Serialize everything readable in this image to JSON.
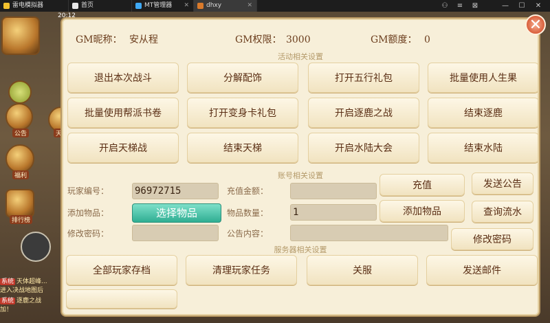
{
  "tabs": [
    {
      "label": "雷电模拟器",
      "color": "#f2c12e"
    },
    {
      "label": "首页",
      "color": "#e8e8e8"
    },
    {
      "label": "MT管理器",
      "color": "#3fa9f5"
    },
    {
      "label": "dhxy",
      "color": "#d97a2b"
    }
  ],
  "window_controls": [
    "⚇",
    "≡",
    "⊠",
    "—",
    "☐",
    "✕"
  ],
  "game": {
    "time_text": "20:12",
    "side_labels": [
      "公告",
      "天",
      "福利",
      "排行榜"
    ],
    "system_messages": [
      {
        "tag": "系统",
        "text": "天体超峰..."
      },
      {
        "tag": "",
        "text": "进入决战地图后"
      },
      {
        "tag": "系统",
        "text": "逐鹿之战"
      },
      {
        "tag": "",
        "text": "加！"
      }
    ]
  },
  "panel": {
    "close_label": "✕",
    "gm_nickname_label": "GM昵称：",
    "gm_nickname_value": "安从程",
    "gm_permission_label": "GM权限：",
    "gm_permission_value": "3000",
    "gm_quota_label": "GM额度：",
    "gm_quota_value": "0",
    "section_activity": "活动相关设置",
    "section_account": "账号相关设置",
    "section_server": "服务器相关设置",
    "activity_buttons": [
      "退出本次战斗",
      "分解配饰",
      "打开五行礼包",
      "批量使用人生果",
      "批量使用帮派书卷",
      "打开变身卡礼包",
      "开启逐鹿之战",
      "结束逐鹿",
      "开启天梯战",
      "结束天梯",
      "开启水陆大会",
      "结束水陆"
    ],
    "account": {
      "player_id_label": "玩家编号：",
      "player_id_value": "96972715",
      "recharge_amount_label": "充值金额：",
      "recharge_amount_value": "",
      "add_item_label": "添加物品：",
      "select_item_button": "选择物品",
      "item_quantity_label": "物品数量：",
      "item_quantity_value": "1",
      "change_password_label": "修改密码：",
      "change_password_value": "",
      "announcement_label": "公告内容：",
      "announcement_value": "",
      "recharge_button": "充值",
      "send_announcement_button": "发送公告",
      "add_item_button": "添加物品",
      "query_flow_button": "查询流水",
      "modify_password_button": "修改密码"
    },
    "server_buttons": [
      "全部玩家存档",
      "清理玩家任务",
      "关服",
      "发送邮件"
    ]
  }
}
